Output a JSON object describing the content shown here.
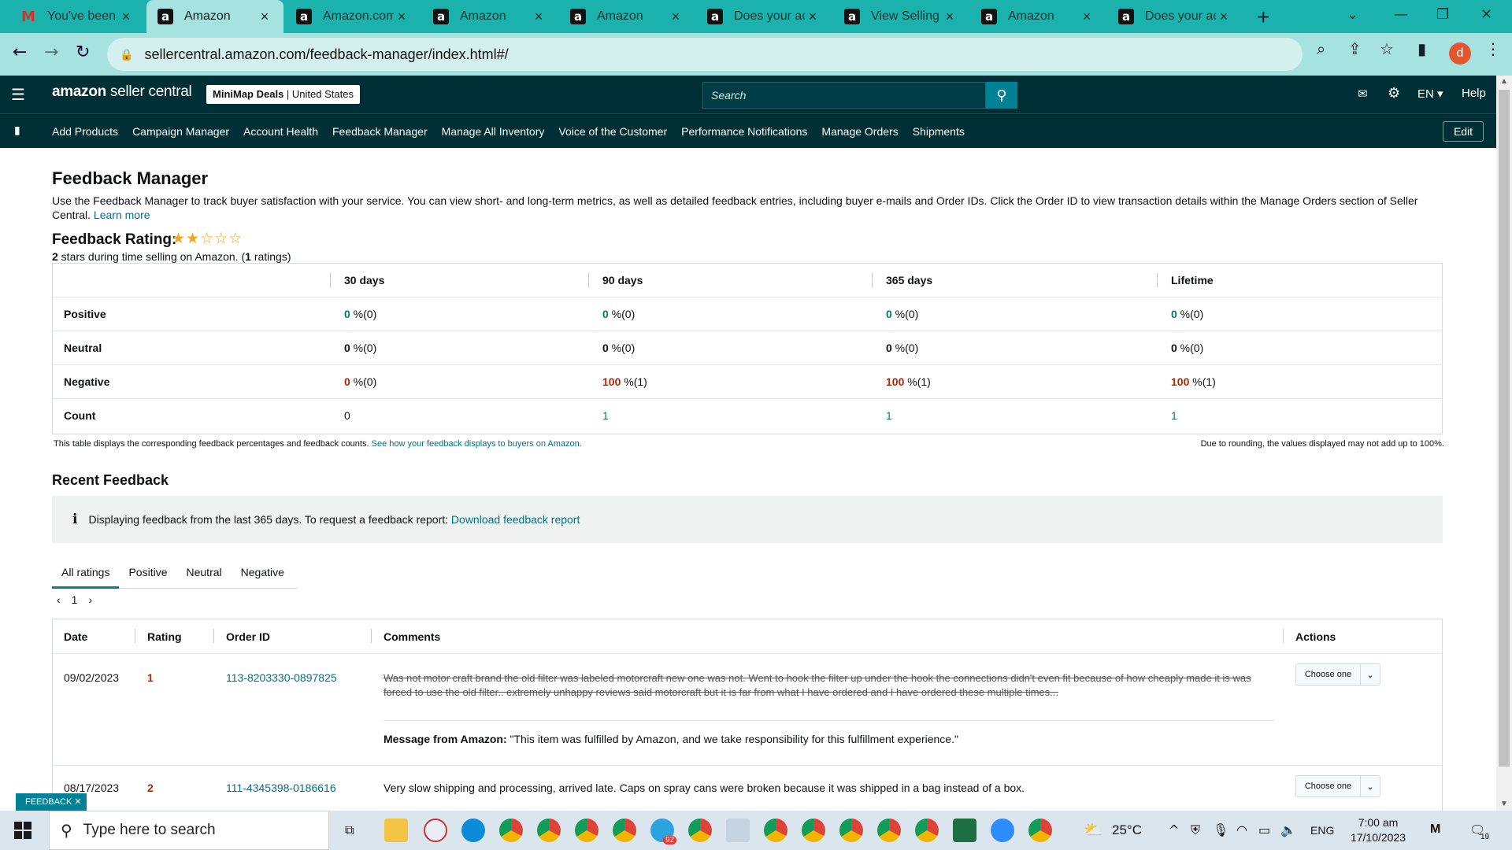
{
  "browser": {
    "tabs": [
      {
        "title": "You've been i",
        "icon": "gmail-icon"
      },
      {
        "title": "Amazon",
        "icon": "amazon-icon",
        "active": true
      },
      {
        "title": "Amazon.com",
        "icon": "amazon-icon"
      },
      {
        "title": "Amazon",
        "icon": "amazon-icon"
      },
      {
        "title": "Amazon",
        "icon": "amazon-icon"
      },
      {
        "title": "Does your ac",
        "icon": "amazon-icon"
      },
      {
        "title": "View Selling /",
        "icon": "amazon-icon"
      },
      {
        "title": "Amazon",
        "icon": "amazon-icon"
      },
      {
        "title": "Does your ac",
        "icon": "amazon-icon"
      }
    ],
    "url": "sellercentral.amazon.com/feedback-manager/index.html#/",
    "profile_initial": "d"
  },
  "header": {
    "brand_bold": "amazon",
    "brand_rest": " seller central",
    "store_name": "MiniMap Deals",
    "store_region": "United States",
    "search_placeholder": "Search",
    "language": "EN",
    "help": "Help"
  },
  "nav": {
    "items": [
      "Add Products",
      "Campaign Manager",
      "Account Health",
      "Feedback Manager",
      "Manage All Inventory",
      "Voice of the Customer",
      "Performance Notifications",
      "Manage Orders",
      "Shipments"
    ],
    "edit": "Edit"
  },
  "page": {
    "title": "Feedback Manager",
    "description": "Use the Feedback Manager to track buyer satisfaction with your service. You can view short- and long-term metrics, as well as detailed feedback entries, including buyer e-mails and Order IDs. Click the Order ID to view transaction details within the Manage Orders section of Seller Central.",
    "learn_more": "Learn more",
    "rating_title": "Feedback Rating:",
    "rating_stars": 2,
    "rating_max": 5,
    "rating_sub_count": "2",
    "rating_sub_text": " stars during time selling on Amazon. (",
    "rating_sub_num": "1",
    "rating_sub_end": " ratings)"
  },
  "metrics": {
    "columns": [
      "30 days",
      "90 days",
      "365 days",
      "Lifetime"
    ],
    "rows": [
      {
        "label": "Positive",
        "values": [
          [
            "0",
            " %(0)"
          ],
          [
            "0",
            " %(0)"
          ],
          [
            "0",
            " %(0)"
          ],
          [
            "0",
            " %(0)"
          ]
        ]
      },
      {
        "label": "Neutral",
        "values": [
          [
            "0",
            " %(0)"
          ],
          [
            "0",
            " %(0)"
          ],
          [
            "0",
            " %(0)"
          ],
          [
            "0",
            " %(0)"
          ]
        ]
      },
      {
        "label": "Negative",
        "values": [
          [
            "0",
            " %(0)"
          ],
          [
            "100",
            " %(1)"
          ],
          [
            "100",
            " %(1)"
          ],
          [
            "100",
            " %(1)"
          ]
        ]
      },
      {
        "label": "Count",
        "values": [
          [
            "0",
            ""
          ],
          [
            "1",
            ""
          ],
          [
            "1",
            ""
          ],
          [
            "1",
            ""
          ]
        ]
      }
    ],
    "note": "This table displays the corresponding feedback percentages and feedback counts.",
    "note_link": "See how your feedback displays to buyers on Amazon.",
    "rounding_note": "Due to rounding, the values displayed may not add up to 100%."
  },
  "recent": {
    "title": "Recent Feedback",
    "info": "Displaying feedback from the last 365 days. To request a feedback report:",
    "info_link": "Download feedback report",
    "tabs": [
      "All ratings",
      "Positive",
      "Neutral",
      "Negative"
    ],
    "page": "1",
    "columns": [
      "Date",
      "Rating",
      "Order ID",
      "Comments",
      "Actions"
    ],
    "rows": [
      {
        "date": "09/02/2023",
        "rating": "1",
        "order_id": "113-8203330-0897825",
        "comment": "Was not motor craft brand the old filter was labeled motorcraft new one was not. Went to hook the filter up under the hook the connections didn't even fit because of how cheaply made it is was forced to use the old filter.. extremely unhappy reviews said motorcraft but it is far from what I have ordered and I have ordered these multiple times...",
        "message_label": "Message from Amazon:",
        "message": " \"This item was fulfilled by Amazon, and we take responsibility for this fulfillment experience.\"",
        "action": "Choose one"
      },
      {
        "date": "08/17/2023",
        "rating": "2",
        "order_id": "111-4345398-0186616",
        "comment": "Very slow shipping and processing, arrived late. Caps on spray cans were broken because it was shipped in a bag instead of a box.",
        "action": "Choose one"
      }
    ]
  },
  "feedback_tab": "FEEDBACK",
  "taskbar": {
    "search_placeholder": "Type here to search",
    "weather": "25°C",
    "language": "ENG",
    "time": "7:00 am",
    "date": "17/10/2023",
    "notifications": "19",
    "telegram_badge": "92"
  }
}
